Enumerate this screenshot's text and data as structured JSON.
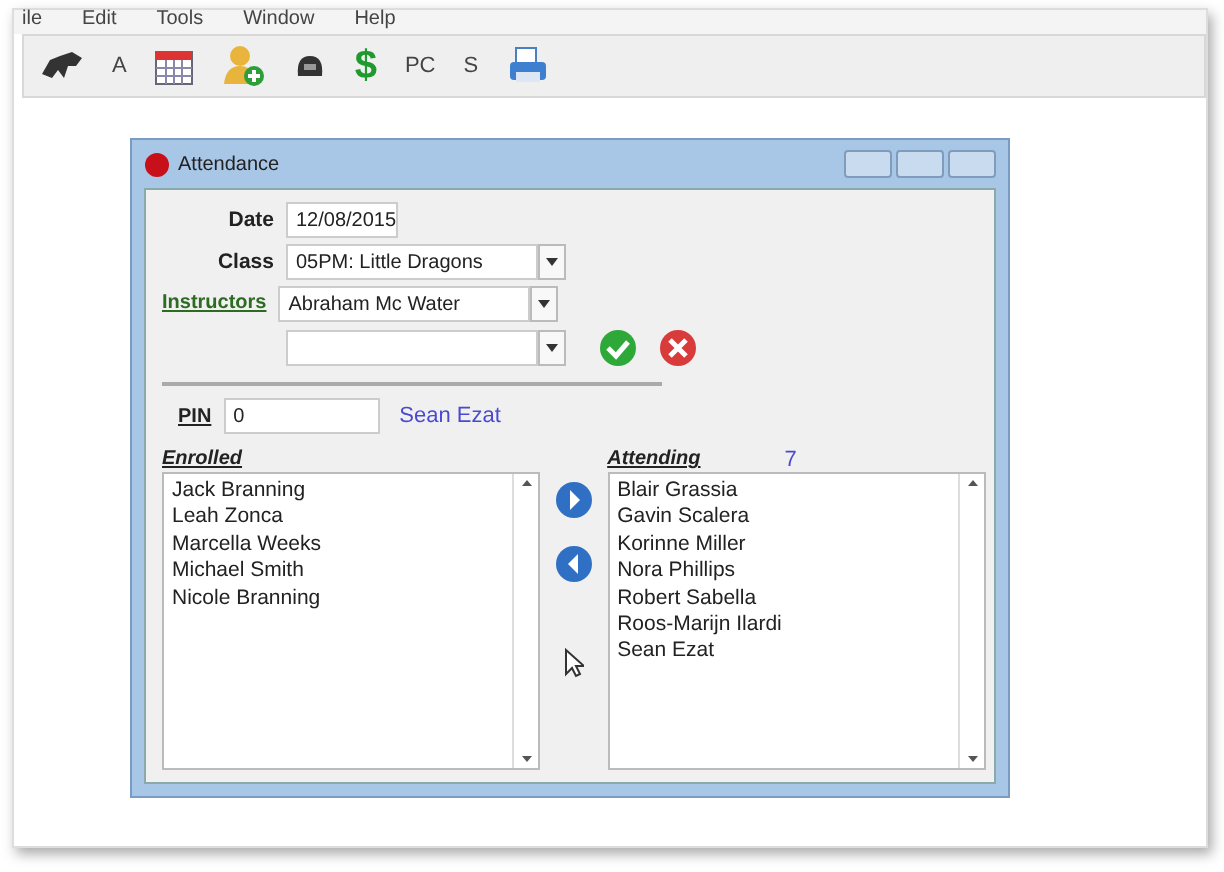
{
  "menu": [
    "ile",
    "Edit",
    "Tools",
    "Window",
    "Help"
  ],
  "toolbar": [
    {
      "kind": "icon"
    },
    {
      "kind": "text",
      "label": "A"
    },
    {
      "kind": "icon"
    },
    {
      "kind": "icon"
    },
    {
      "kind": "icon"
    },
    {
      "kind": "text",
      "label": "$",
      "color": "#1f9a2e"
    },
    {
      "kind": "text",
      "label": "PC"
    },
    {
      "kind": "text",
      "label": "S"
    },
    {
      "kind": "icon"
    }
  ],
  "window": {
    "title": "Attendance",
    "date": {
      "label": "Date",
      "value": "12/08/2015"
    },
    "class": {
      "label": "Class",
      "value": "05PM: Little Dragons"
    },
    "instructors": {
      "label": "Instructors",
      "value": "Abraham Mc Water"
    },
    "pin": {
      "label": "PIN",
      "value": "0",
      "name": "Sean Ezat"
    },
    "enrolled": {
      "label": "Enrolled",
      "items": [
        "Jack Branning",
        "Leah Zonca",
        "Marcella Weeks",
        "Michael Smith",
        "Nicole Branning"
      ]
    },
    "attending": {
      "label": "Attending",
      "count": "7",
      "items": [
        "Blair Grassia",
        "Gavin Scalera",
        "Korinne Miller",
        "Nora Phillips",
        "Robert Sabella",
        "Roos-Marijn Ilardi",
        "Sean Ezat"
      ]
    }
  }
}
